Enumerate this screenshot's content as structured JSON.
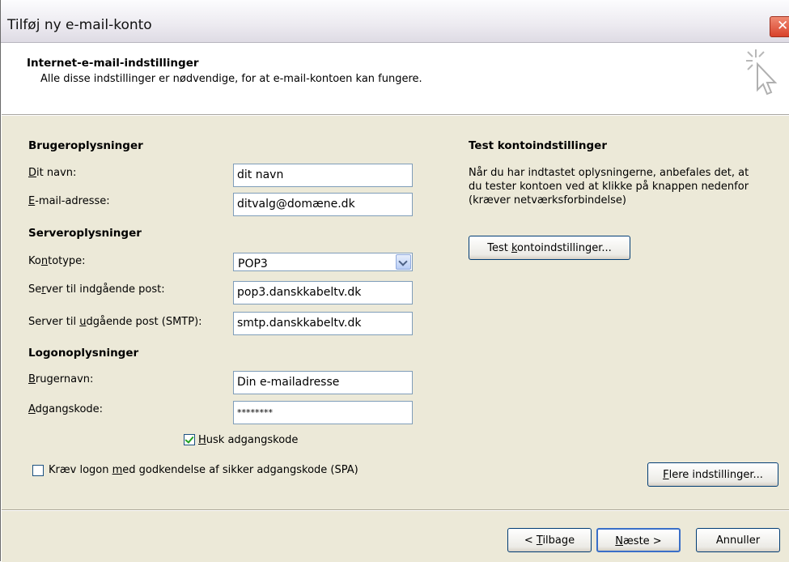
{
  "window": {
    "title": "Tilføj ny e-mail-konto"
  },
  "header": {
    "title": "Internet-e-mail-indstillinger",
    "subtitle": "Alle disse indstillinger er nødvendige, for at e-mail-kontoen kan fungere."
  },
  "user_info": {
    "heading": "Brugeroplysninger",
    "name": {
      "label_pre": "",
      "label_key": "D",
      "label_post": "it navn:",
      "value": "dit navn"
    },
    "email": {
      "label_pre": "",
      "label_key": "E",
      "label_post": "-mail-adresse:",
      "value": "ditvalg@domæne.dk"
    }
  },
  "server_info": {
    "heading": "Serveroplysninger",
    "account_type": {
      "label_pre": "Ko",
      "label_key": "n",
      "label_post": "totype:",
      "value": "POP3"
    },
    "incoming": {
      "label_pre": "Se",
      "label_key": "r",
      "label_post": "ver til indgående post:",
      "value": "pop3.danskkabeltv.dk"
    },
    "outgoing": {
      "label_pre": "Server til ",
      "label_key": "u",
      "label_post": "dgående post (SMTP):",
      "value": "smtp.danskkabeltv.dk"
    }
  },
  "logon_info": {
    "heading": "Logonoplysninger",
    "username": {
      "label_pre": "",
      "label_key": "B",
      "label_post": "rugernavn:",
      "value": "Din e-mailadresse"
    },
    "password": {
      "label_pre": "",
      "label_key": "A",
      "label_post": "dgangskode:",
      "value": "********"
    },
    "remember": {
      "label_pre": "",
      "label_key": "H",
      "label_post": "usk adgangskode",
      "checked": true
    },
    "spa": {
      "label_pre": "Kræv logon ",
      "label_key": "m",
      "label_post": "ed godkendelse af sikker adgangskode (SPA)",
      "checked": false
    }
  },
  "test": {
    "heading": "Test kontoindstillinger",
    "line1": "Når du har indtastet oplysningerne, anbefales det, at",
    "line2": "du tester kontoen ved at klikke på knappen nedenfor",
    "line3": "(kræver netværksforbindelse)",
    "button": {
      "pre": "Test ",
      "key": "k",
      "post": "ontoindstillinger..."
    }
  },
  "more_button": {
    "pre": "",
    "key": "F",
    "post": "lere indstillinger..."
  },
  "footer": {
    "back": {
      "pre": "< ",
      "key": "T",
      "post": "ilbage"
    },
    "next": {
      "pre": "",
      "key": "N",
      "post": "æste >"
    },
    "cancel": "Annuller"
  }
}
